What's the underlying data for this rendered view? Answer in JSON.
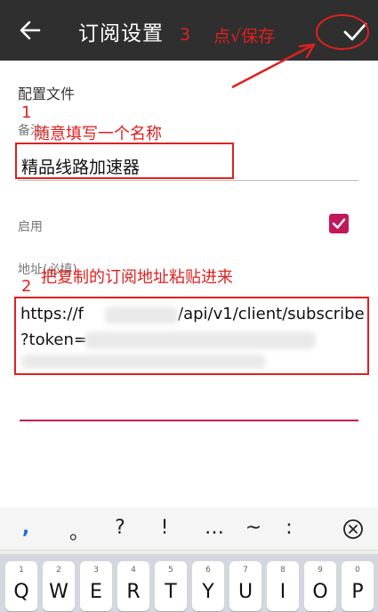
{
  "appbar": {
    "title": "订阅设置"
  },
  "annotations": {
    "step3_number": "3",
    "step3_text": "点√保存",
    "step1_number": "1",
    "step1_text": "随意填写一个名称",
    "step2_number": "2",
    "step2_text": "把复制的订阅地址粘贴进来"
  },
  "form": {
    "section_title": "配置文件",
    "remark_label": "备注",
    "remark_value": "精品线路加速器",
    "enable_label": "启用",
    "enable_checked": true,
    "address_label": "地址(必填)",
    "address_line1_start": "https://f",
    "address_line1_end": "/api/v1/client/subscribe",
    "address_line2": "?token="
  },
  "keyboard": {
    "symbols": [
      ",",
      "。",
      "?",
      "!",
      "…",
      "~",
      ":"
    ],
    "delete_icon": "clear-icon",
    "keys": [
      {
        "num": "1",
        "letter": "Q"
      },
      {
        "num": "2",
        "letter": "W"
      },
      {
        "num": "3",
        "letter": "E"
      },
      {
        "num": "4",
        "letter": "R"
      },
      {
        "num": "5",
        "letter": "T"
      },
      {
        "num": "6",
        "letter": "Y"
      },
      {
        "num": "7",
        "letter": "U"
      },
      {
        "num": "8",
        "letter": "I"
      },
      {
        "num": "9",
        "letter": "O"
      },
      {
        "num": "0",
        "letter": "P"
      }
    ]
  },
  "colors": {
    "appbar": "#2f2f2f",
    "accent": "#c2185b",
    "annotation": "#e02020"
  }
}
